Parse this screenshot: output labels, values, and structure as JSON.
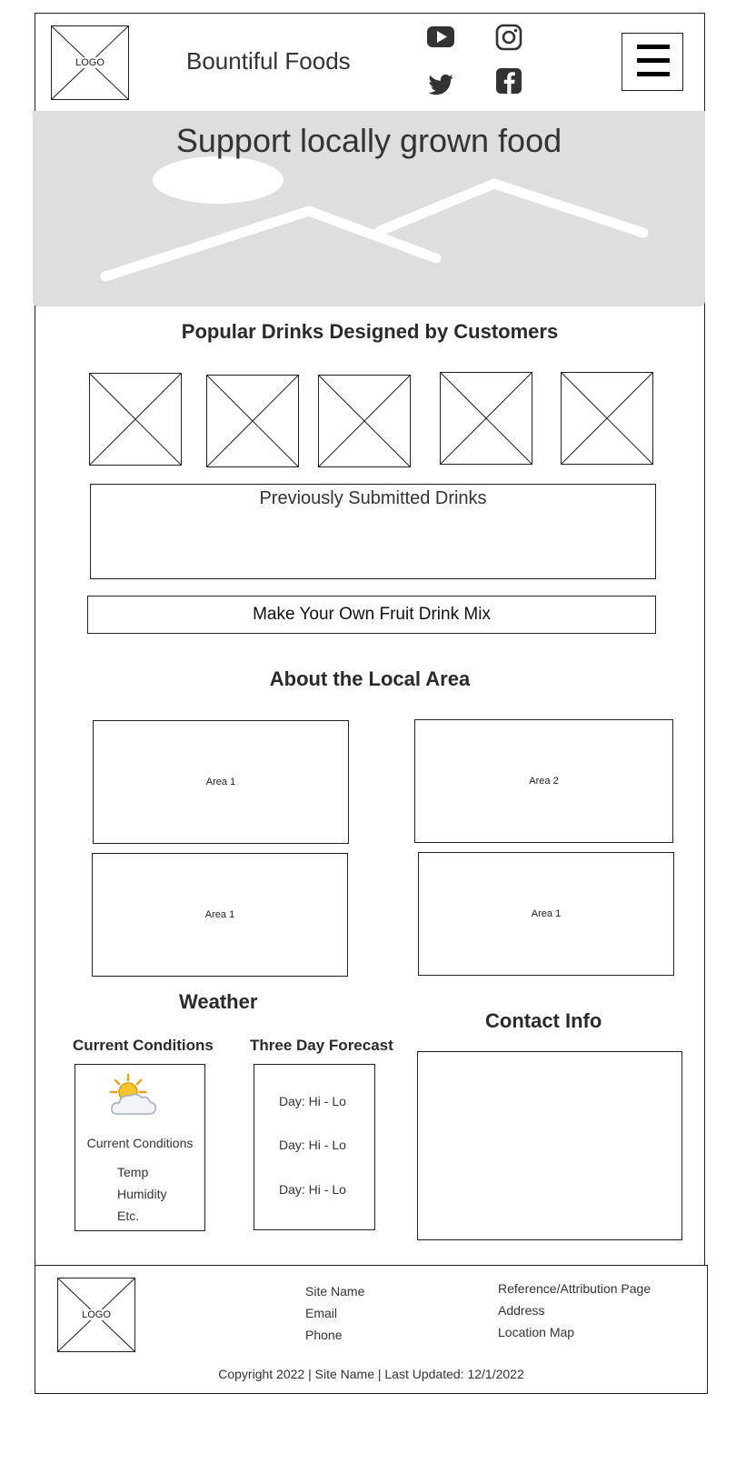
{
  "header": {
    "logo_label": "LOGO",
    "brand": "Bountiful Foods",
    "social": [
      "youtube-icon",
      "instagram-icon",
      "twitter-icon",
      "facebook-icon"
    ],
    "menu_icon": "hamburger-menu-icon"
  },
  "hero": {
    "title": "Support locally grown food"
  },
  "drinks": {
    "title": "Popular Drinks Designed by Customers",
    "previous_label": "Previously Submitted Drinks",
    "cta_label": "Make Your Own Fruit Drink Mix"
  },
  "area": {
    "title": "About the Local Area",
    "cards": [
      "Area 1",
      "Area 2",
      "Area 1",
      "Area 1"
    ]
  },
  "weather": {
    "title": "Weather",
    "current_title": "Current Conditions",
    "current_icon": "sun-behind-cloud-icon",
    "current_label": "Current Conditions",
    "details": [
      "Temp",
      "Humidity",
      "Etc."
    ],
    "forecast_title": "Three Day Forecast",
    "forecast": [
      "Day: Hi - Lo",
      "Day: Hi - Lo",
      "Day: Hi - Lo"
    ]
  },
  "contact": {
    "title": "Contact Info"
  },
  "footer": {
    "logo_label": "LOGO",
    "col1": [
      "Site Name",
      "Email",
      "Phone"
    ],
    "col2": [
      "Reference/Attribution Page",
      "Address",
      "Location Map"
    ],
    "copyright": "Copyright 2022 | Site Name | Last Updated: 12/1/2022"
  }
}
